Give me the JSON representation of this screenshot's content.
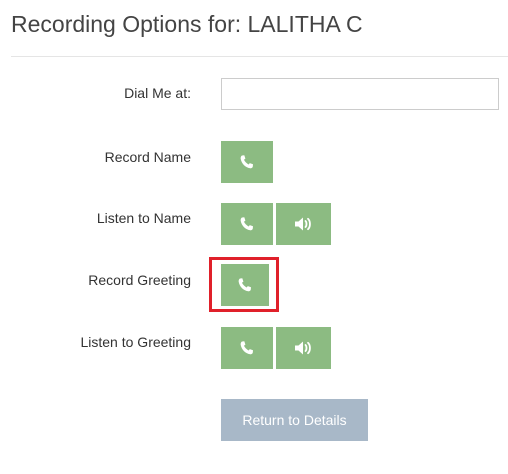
{
  "header": {
    "title": "Recording Options for: LALITHA C"
  },
  "dial_me": {
    "label": "Dial Me at:",
    "value": "",
    "placeholder": ""
  },
  "options": [
    {
      "label": "Record Name",
      "buttons": [
        "phone-icon"
      ]
    },
    {
      "label": "Listen to Name",
      "buttons": [
        "phone-icon",
        "speaker-icon"
      ]
    },
    {
      "label": "Record Greeting",
      "buttons": [
        "phone-icon"
      ],
      "highlighted": true
    },
    {
      "label": "Listen to Greeting",
      "buttons": [
        "phone-icon",
        "speaker-icon"
      ]
    }
  ],
  "footer": {
    "return_label": "Return to Details"
  },
  "colors": {
    "button_green": "#8cbb82",
    "return_button": "#a8b8c8",
    "highlight_red": "#e0202a"
  }
}
